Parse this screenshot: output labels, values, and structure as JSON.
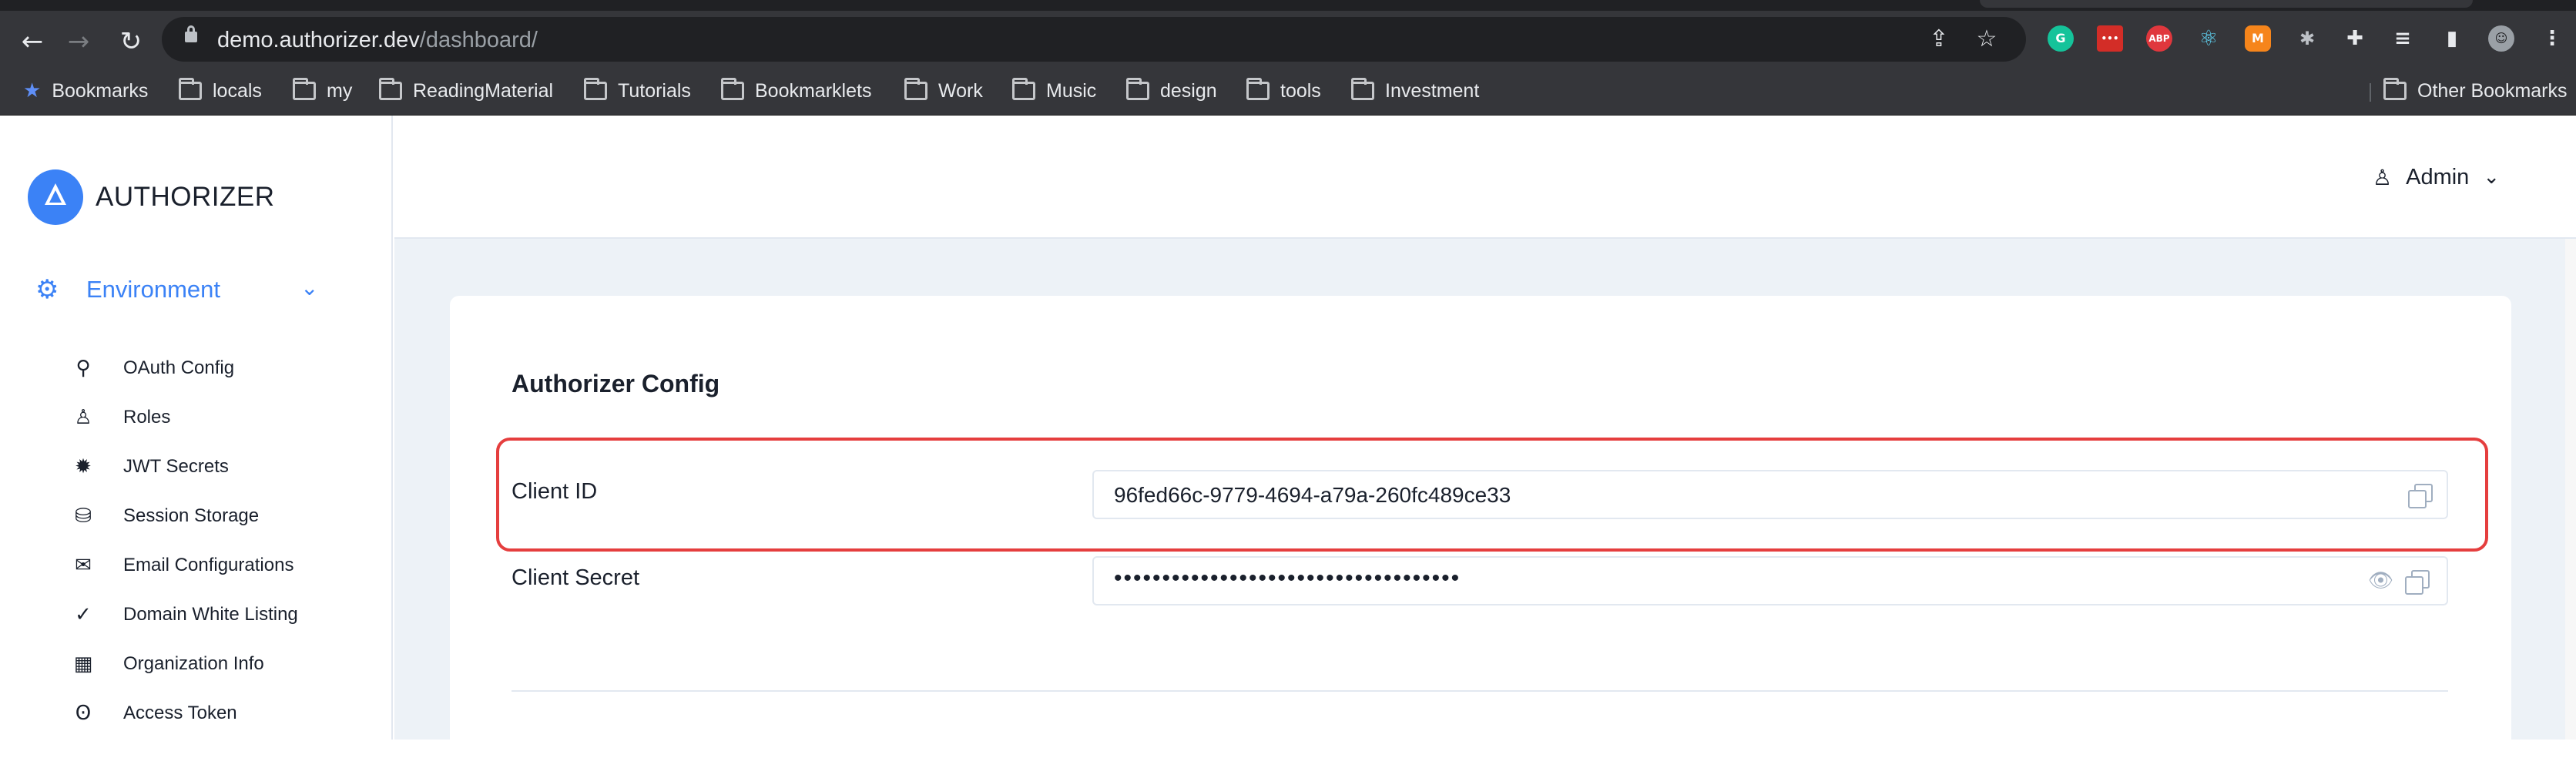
{
  "browser": {
    "url_host": "demo.authorizer.dev",
    "url_path": "/dashboard/",
    "nav_icons": [
      "back-arrow-icon",
      "forward-arrow-icon",
      "reload-icon"
    ],
    "extensions": [
      {
        "name": "grammarly-icon",
        "color": "#15c39a",
        "text": "G"
      },
      {
        "name": "lastpass-icon",
        "color": "#d32d27",
        "text": "•••"
      },
      {
        "name": "adblock-plus-icon",
        "color": "#e0373d",
        "text": "ABP"
      },
      {
        "name": "react-devtools-icon",
        "color": "#35363a",
        "text": "⚛"
      },
      {
        "name": "metamask-icon",
        "color": "#35363a",
        "text": "🦊"
      }
    ],
    "bookmarks": [
      {
        "label": "Bookmarks",
        "icon": "star-icon"
      },
      {
        "label": "locals",
        "icon": "folder-icon"
      },
      {
        "label": "my",
        "icon": "folder-icon"
      },
      {
        "label": "ReadingMaterial",
        "icon": "folder-icon"
      },
      {
        "label": "Tutorials",
        "icon": "folder-icon"
      },
      {
        "label": "Bookmarklets",
        "icon": "folder-icon"
      },
      {
        "label": "Work",
        "icon": "folder-icon"
      },
      {
        "label": "Music",
        "icon": "folder-icon"
      },
      {
        "label": "design",
        "icon": "folder-icon"
      },
      {
        "label": "tools",
        "icon": "folder-icon"
      },
      {
        "label": "Investment",
        "icon": "folder-icon"
      }
    ],
    "other_bookmarks": "Other Bookmarks"
  },
  "sidebar": {
    "brand": "AUTHORIZER",
    "section": "Environment",
    "items": [
      {
        "label": "OAuth Config",
        "icon": "key-icon"
      },
      {
        "label": "Roles",
        "icon": "user-icon"
      },
      {
        "label": "JWT Secrets",
        "icon": "gear-burst-icon"
      },
      {
        "label": "Session Storage",
        "icon": "database-icon"
      },
      {
        "label": "Email Configurations",
        "icon": "mail-icon"
      },
      {
        "label": "Domain White Listing",
        "icon": "check-circle-icon"
      },
      {
        "label": "Organization Info",
        "icon": "building-icon"
      },
      {
        "label": "Access Token",
        "icon": "lock-open-icon"
      }
    ]
  },
  "header": {
    "user": "Admin"
  },
  "config": {
    "title": "Authorizer Config",
    "client_id_label": "Client ID",
    "client_id_value": "96fed66c-9779-4694-a79a-260fc489ce33",
    "client_secret_label": "Client Secret",
    "client_secret_masked": "••••••••••••••••••••••••••••••••••••",
    "highlight_color": "#e53e3e",
    "accent": "#3b82f6"
  }
}
